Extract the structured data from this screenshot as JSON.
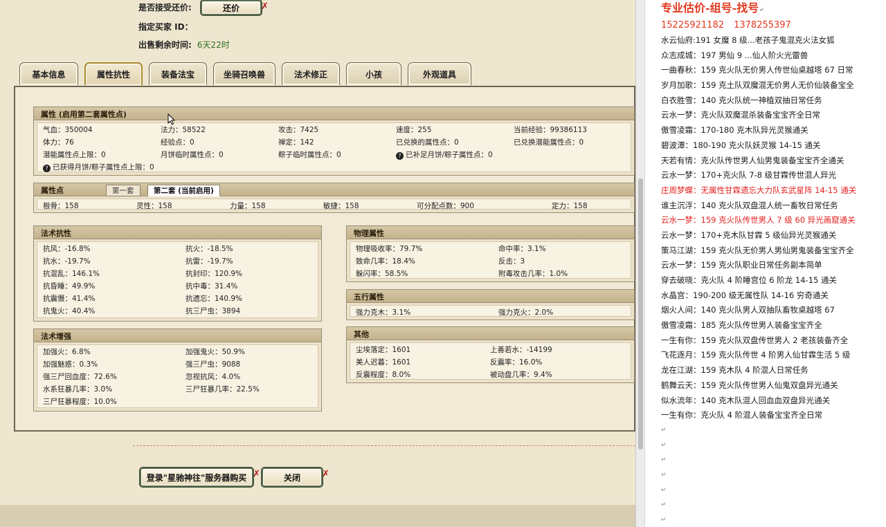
{
  "header": {
    "accept_counter_label": "是否接受还价:",
    "counter_button": "还价",
    "buyer_id_label": "指定买家 ID：",
    "time_left_label": "出售剩余时间:",
    "time_left_value": "6天22时"
  },
  "tabs": [
    "基本信息",
    "属性抗性",
    "装备法宝",
    "坐骑召唤兽",
    "法术修正",
    "小孩",
    "外观道具"
  ],
  "attributes": {
    "title": "属性 (启用第二套属性点)",
    "rows": [
      [
        "气血：350004",
        "法力：58522",
        "攻击：7425",
        "速度：255",
        "当前经验：99386113"
      ],
      [
        "体力：76",
        "经验点：0",
        "禅定：142",
        "已兑换的属性点：0",
        "已兑换潜能属性点：0"
      ],
      [
        "潜能属性点上限：0",
        "月饼临时属性点：0",
        "粽子临时属性点：0",
        "已补足月饼/粽子属性点：0"
      ],
      [
        "已获得月饼/粽子属性点上限：0"
      ]
    ]
  },
  "attr_points": {
    "title": "属性点",
    "tab1": "第一套",
    "tab2": "第二套 (当前启用)",
    "values": [
      "根骨：158",
      "灵性：158",
      "力量：158",
      "敏捷：158",
      "可分配点数：900",
      "定力：158"
    ]
  },
  "spell_resist": {
    "title": "法术抗性",
    "rows": [
      [
        "抗风：-16.8%",
        "抗火：-18.5%"
      ],
      [
        "抗水：-19.7%",
        "抗雷：-19.7%"
      ],
      [
        "抗混乱：146.1%",
        "抗封印：120.9%"
      ],
      [
        "抗昏睡：49.9%",
        "抗中毒：31.4%"
      ],
      [
        "抗震慑：41.4%",
        "抗遗忘：140.9%"
      ],
      [
        "抗鬼火：40.4%",
        "抗三尸虫：3894"
      ]
    ]
  },
  "spell_boost": {
    "title": "法术增强",
    "rows": [
      [
        "加强火：6.8%",
        "加强鬼火：50.9%"
      ],
      [
        "加强魅惑：0.3%",
        "强三尸虫：9088"
      ],
      [
        "强三尸回血度：72.6%",
        "忽视抗风：4.0%"
      ],
      [
        "水系狂暴几率：3.0%",
        "三尸狂暴几率：22.5%"
      ],
      [
        "三尸狂暴程度：10.0%",
        ""
      ]
    ]
  },
  "physical": {
    "title": "物理属性",
    "rows": [
      [
        "物理吸收率：79.7%",
        "命中率：3.1%"
      ],
      [
        "致命几率：18.4%",
        "反击：3"
      ],
      [
        "躲闪率：58.5%",
        "附毒攻击几率：1.0%"
      ]
    ]
  },
  "five_elements": {
    "title": "五行属性",
    "rows": [
      [
        "强力克木：3.1%",
        "强力克火：2.0%"
      ]
    ]
  },
  "other": {
    "title": "其他",
    "rows": [
      [
        "尘埃落定：1601",
        "上善若水：-14199"
      ],
      [
        "美人迟暮：1601",
        "反震率：16.0%"
      ],
      [
        "反震程度：8.0%",
        "被动盘几率：9.4%"
      ]
    ]
  },
  "footer": {
    "login_buy_button": "登录\"星驰神往\"服务器购买",
    "close_button": "关闭"
  },
  "notes": {
    "title": "专业估价-组号-找号",
    "phones": "15225921182   1378255397",
    "lines": [
      {
        "text": "水云仙府:191 女魔 8 级...老孩子鬼混克火法女狐",
        "red": false
      },
      {
        "text": "众志成城：197 男仙 9 ...仙人阶火光雷兽",
        "red": false
      },
      {
        "text": "一曲春秋：159 克火队无价男人传世仙桌越塔 67 日常",
        "red": false
      },
      {
        "text": "岁月加歌：159 克土队双魔混无价男人无价仙装备宝全",
        "red": false
      },
      {
        "text": "白衣胜雪：140 克火队统一神植双抽日常任务",
        "red": false
      },
      {
        "text": "云水一梦：克火队双魔混杀装备宝宝齐全日常",
        "red": false
      },
      {
        "text": "傲雪凌霜：170-180 克木队异光灵猴通关",
        "red": false
      },
      {
        "text": "碧波潭：180-190 克火队妖灵猴 14-15 通关",
        "red": false
      },
      {
        "text": "天若有情：克火队传世男人仙男鬼装备宝宝齐全通关",
        "red": false
      },
      {
        "text": "云水一梦：170+克火队 7-8 级甘霖传世混人异光",
        "red": false
      },
      {
        "text": "庄周梦蝶：无属性甘霖遗忘大力队玄武星阵 14-15 通关",
        "red": true
      },
      {
        "text": "谁主沉浮：140 克火队双盘混人统一畜牧日常任务",
        "red": false
      },
      {
        "text": "云水一梦：159 克火队传世男人 7 级 60 异光画窟通关",
        "red": true
      },
      {
        "text": "云水一梦：170+克木队甘霖 5 级仙异光灵猴通关",
        "red": false
      },
      {
        "text": "策马江湖：159 克火队无价男人男仙男鬼装备宝宝齐全",
        "red": false
      },
      {
        "text": "云水一梦：159 克火队职业日常任务副本简单",
        "red": false
      },
      {
        "text": "穿去破晓：克火队 4 阶睡宫位 6 阶龙 14-15 通关",
        "red": false
      },
      {
        "text": "水晶宫：190-200 级无属性队 14-16 穷奇通关",
        "red": false
      },
      {
        "text": "烟火人间：140 克火队男人双抽队畜牧桌越塔 67",
        "red": false
      },
      {
        "text": "傲雪凌霜：185 克火队传世男人装备宝宝齐全",
        "red": false
      },
      {
        "text": "一生有你：159 克火队双盘传世男人 2 老孩装备齐全",
        "red": false
      },
      {
        "text": "飞花逐月：159 克火队传世 4 阶男人仙甘霖生活 5 级",
        "red": false
      },
      {
        "text": "龙在江湖：159 克木队 4 阶混人日常任务",
        "red": false
      },
      {
        "text": "鹤舞云天：159 克火队传世男人仙鬼双盘异光通关",
        "red": false
      },
      {
        "text": "似水流年：140 克木队混人回血血双盘异光通关",
        "red": false
      },
      {
        "text": "一生有你：克火队 4 阶混人装备宝宝齐全日常",
        "red": false
      }
    ],
    "paragraph_mark": "↵"
  }
}
